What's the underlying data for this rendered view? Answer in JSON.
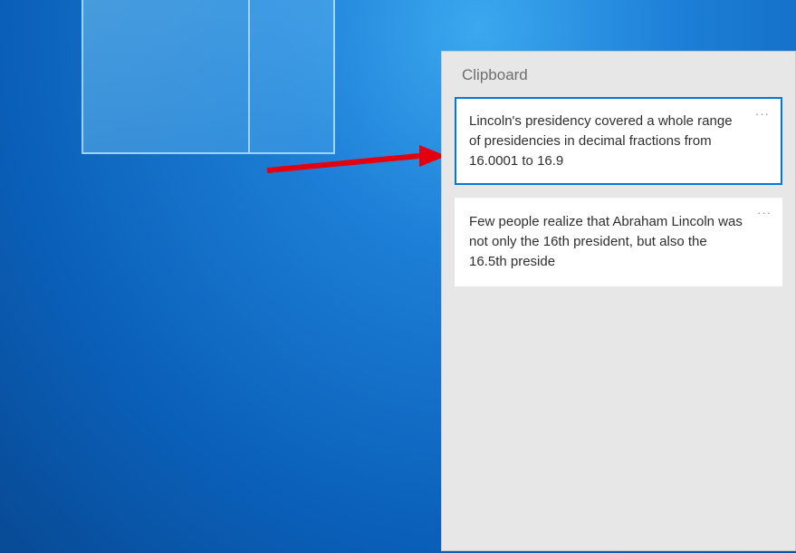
{
  "clipboard": {
    "title": "Clipboard",
    "items": [
      {
        "text": "Lincoln's presidency covered a whole range of presidencies in decimal fractions from 16.0001 to 16.9",
        "selected": true
      },
      {
        "text": "Few people realize that Abraham Lincoln was not only the 16th president, but also the 16.5th preside",
        "selected": false
      }
    ],
    "more_glyph": "···"
  }
}
